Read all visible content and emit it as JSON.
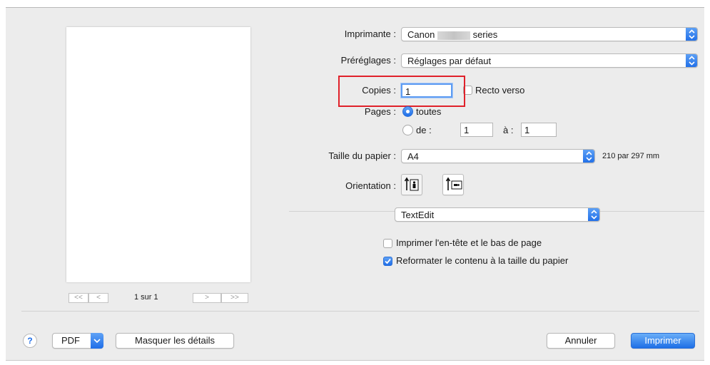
{
  "printer": {
    "label": "Imprimante :",
    "value_prefix": "Canon",
    "value_suffix": "series"
  },
  "presets": {
    "label": "Préréglages :",
    "value": "Réglages par défaut"
  },
  "copies": {
    "label": "Copies :",
    "value": "1",
    "duplex_label": "Recto verso",
    "duplex_checked": false
  },
  "pages": {
    "label": "Pages :",
    "all_label": "toutes",
    "range_label": "de :",
    "from": "1",
    "to_label": "à :",
    "to": "1",
    "selected": "toutes"
  },
  "paper_size": {
    "label": "Taille du papier :",
    "value": "A4",
    "dimensions": "210 par 297 mm"
  },
  "orientation": {
    "label": "Orientation :",
    "selected": "portrait"
  },
  "app_panel": {
    "value": "TextEdit"
  },
  "options": [
    {
      "label": "Imprimer l'en-tête et le bas de page",
      "checked": false
    },
    {
      "label": "Reformater le contenu à la taille du papier",
      "checked": true
    }
  ],
  "preview_nav": {
    "first": "<<",
    "prev": "<",
    "page_indicator": "1 sur 1",
    "next": ">",
    "last": ">>"
  },
  "footer": {
    "help": "?",
    "pdf": "PDF",
    "hide_details": "Masquer les détails",
    "cancel": "Annuler",
    "print": "Imprimer"
  },
  "colors": {
    "accent": "#1f6ee8",
    "highlight": "#e0212a"
  }
}
